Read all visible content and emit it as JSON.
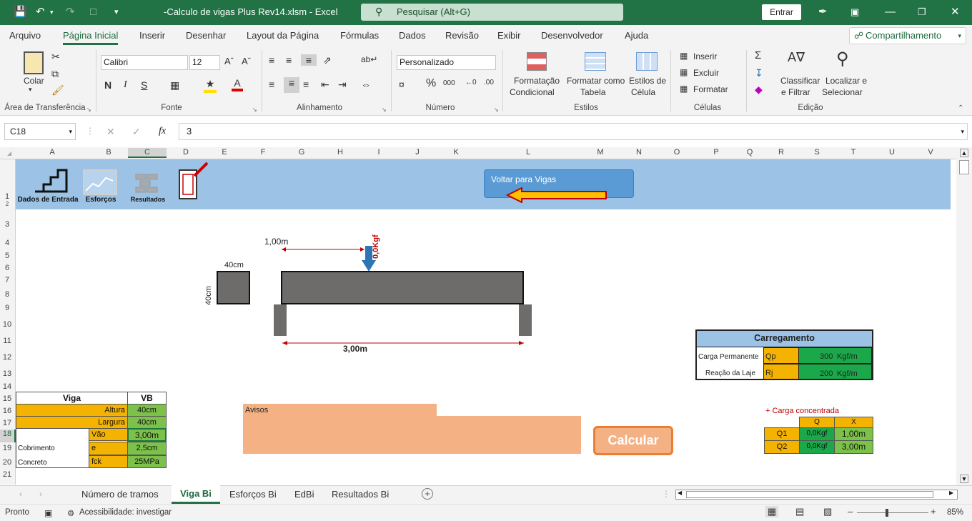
{
  "window": {
    "title": "-Calculo de vigas Plus Rev14.xlsm  -  Excel",
    "search_placeholder": "Pesquisar (Alt+G)",
    "signin": "Entrar"
  },
  "menu": {
    "tabs": [
      "Arquivo",
      "Página Inicial",
      "Inserir",
      "Desenhar",
      "Layout da Página",
      "Fórmulas",
      "Dados",
      "Revisão",
      "Exibir",
      "Desenvolvedor",
      "Ajuda"
    ],
    "active": "Página Inicial",
    "share": "Compartilhamento"
  },
  "ribbon": {
    "clipboard": {
      "paste": "Colar",
      "label": "Área de Transferência"
    },
    "font": {
      "name": "Calibri",
      "size": "12",
      "bold": "N",
      "italic": "I",
      "underline": "S",
      "label": "Fonte"
    },
    "alignment": {
      "label": "Alinhamento"
    },
    "number": {
      "format": "Personalizado",
      "label": "Número"
    },
    "styles": {
      "conditional_1": "Formatação",
      "conditional_2": "Condicional",
      "table_1": "Formatar como",
      "table_2": "Tabela",
      "cell_1": "Estilos de",
      "cell_2": "Célula",
      "label": "Estilos"
    },
    "cells": {
      "insert": "Inserir",
      "delete": "Excluir",
      "format": "Formatar",
      "label": "Células"
    },
    "editing": {
      "sort_1": "Classificar",
      "sort_2": "e Filtrar",
      "find_1": "Localizar e",
      "find_2": "Selecionar",
      "label": "Edição"
    }
  },
  "formula_bar": {
    "name_box": "C18",
    "fx": "fx",
    "value": "3"
  },
  "columns": [
    "A",
    "B",
    "C",
    "D",
    "E",
    "F",
    "G",
    "H",
    "I",
    "J",
    "K",
    "L",
    "M",
    "N",
    "O",
    "P",
    "Q",
    "R",
    "S",
    "T",
    "U",
    "V"
  ],
  "rows": [
    "1",
    "2",
    "3",
    "4",
    "5",
    "6",
    "7",
    "8",
    "9",
    "10",
    "11",
    "12",
    "13",
    "14",
    "15",
    "16",
    "17",
    "18",
    "19",
    "20",
    "21"
  ],
  "banner": {
    "nav": [
      "Dados de Entrada",
      "Esforços",
      "Resultados"
    ],
    "voltar": "Voltar para Vigas"
  },
  "drawing": {
    "load_distance": "1,00m",
    "load_value": "0,0Kgf",
    "section_width": "40cm",
    "section_height": "40cm",
    "span": "3,00m"
  },
  "carregamento": {
    "title": "Carregamento",
    "rows": [
      {
        "label": "Carga Permanente",
        "code": "Qp",
        "value": "300",
        "unit": "Kgf/m"
      },
      {
        "label": "Reação da Laje",
        "code": "Rj",
        "value": "200",
        "unit": "Kgf/m"
      }
    ]
  },
  "viga_table": {
    "header": [
      "Viga",
      "VB"
    ],
    "altura": {
      "label": "Altura",
      "value": "40cm"
    },
    "largura": {
      "label": "Largura",
      "value": "40cm"
    },
    "vao": {
      "label": "Vão",
      "value": "3,00m"
    },
    "cobrimento": {
      "group": "Cobrimento",
      "label": "e",
      "value": "2,5cm"
    },
    "concreto": {
      "group": "Concreto",
      "label": "fck",
      "value": "25MPa"
    }
  },
  "avisos": {
    "label": "Avisos"
  },
  "calcular": "Calcular",
  "concentrada": {
    "title": "+ Carga concentrada",
    "headers": [
      "Q",
      "X"
    ],
    "rows": [
      {
        "name": "Q1",
        "q": "0,0Kgf",
        "x": "1,00m"
      },
      {
        "name": "Q2",
        "q": "0,0Kgf",
        "x": "3,00m"
      }
    ]
  },
  "sheets": {
    "tabs": [
      "Número de tramos",
      "Viga Bi",
      "Esforços Bi",
      "EdBi",
      "Resultados Bi"
    ],
    "active": "Viga Bi"
  },
  "status": {
    "ready": "Pronto",
    "accessibility": "Acessibilidade: investigar",
    "zoom": "85%"
  }
}
